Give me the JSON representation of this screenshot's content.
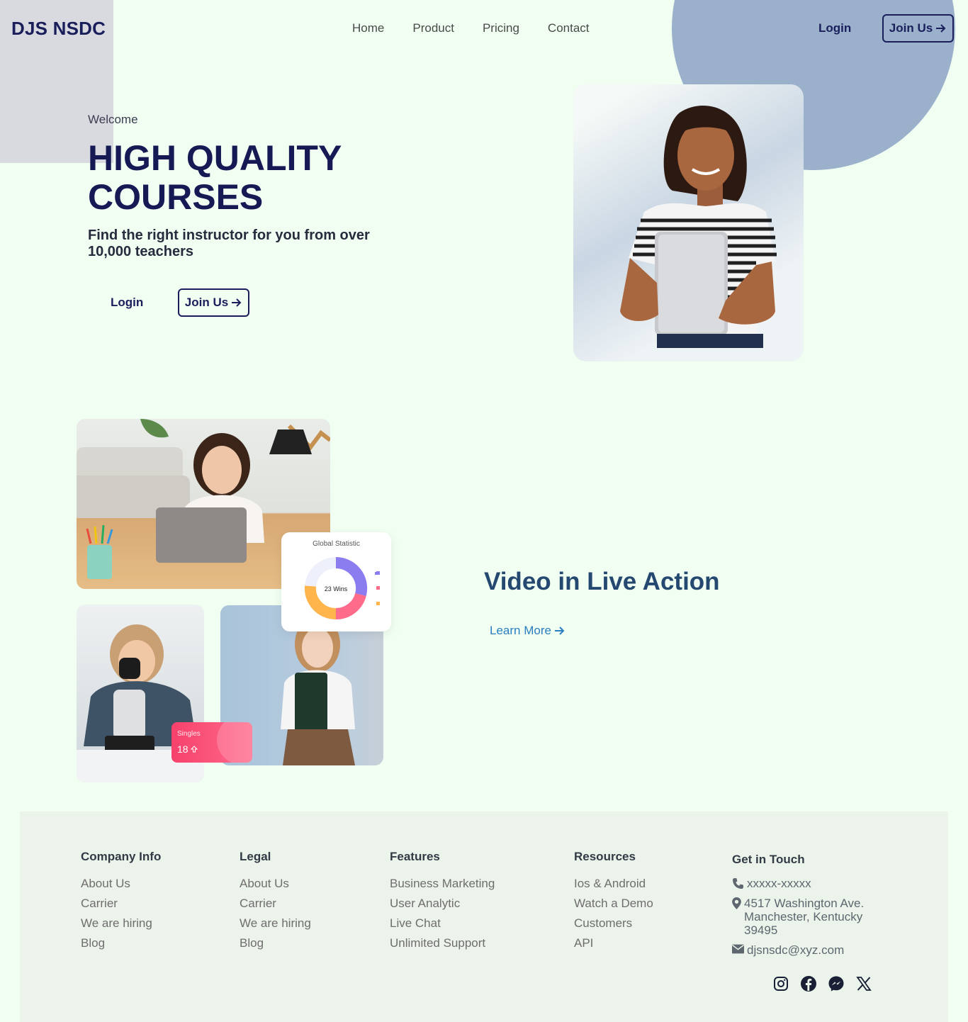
{
  "header": {
    "logo": "DJS NSDC",
    "nav": [
      "Home",
      "Product",
      "Pricing",
      "Contact"
    ],
    "login": "Login",
    "join": "Join Us"
  },
  "hero": {
    "welcome": "Welcome",
    "headline": "HIGH QUALITY COURSES",
    "subline": "Find the right instructor for you from over 10,000 teachers",
    "login": "Login",
    "join": "Join Us"
  },
  "stats": {
    "title": "Global Statistic",
    "center": "23 Wins",
    "singles_label": "Singles",
    "singles_value": "18"
  },
  "video": {
    "title": "Video in Live Action",
    "cta": "Learn More"
  },
  "footer": {
    "columns": [
      {
        "title": "Company Info",
        "links": [
          "About Us",
          "Carrier",
          "We are hiring",
          "Blog"
        ]
      },
      {
        "title": "Legal",
        "links": [
          "About Us",
          "Carrier",
          "We are hiring",
          "Blog"
        ]
      },
      {
        "title": "Features",
        "links": [
          "Business Marketing",
          "User Analytic",
          "Live Chat",
          "Unlimited Support"
        ]
      },
      {
        "title": "Resources",
        "links": [
          "Ios & Android",
          "Watch a Demo",
          "Customers",
          "API"
        ]
      }
    ],
    "contact": {
      "title": "Get in Touch",
      "phone": "xxxxx-xxxxx",
      "address": "4517 Washington Ave. Manchester, Kentucky 39495",
      "email": "djsnsdc@xyz.com"
    },
    "socials": [
      "instagram-icon",
      "facebook-icon",
      "messenger-icon",
      "x-icon"
    ]
  },
  "colors": {
    "background": "#f0fff2",
    "brand_navy": "#1a1f5c",
    "accent_blue": "#9ab0cb",
    "link_blue": "#2a7ec2",
    "footer_bg": "#ecf3ea"
  }
}
